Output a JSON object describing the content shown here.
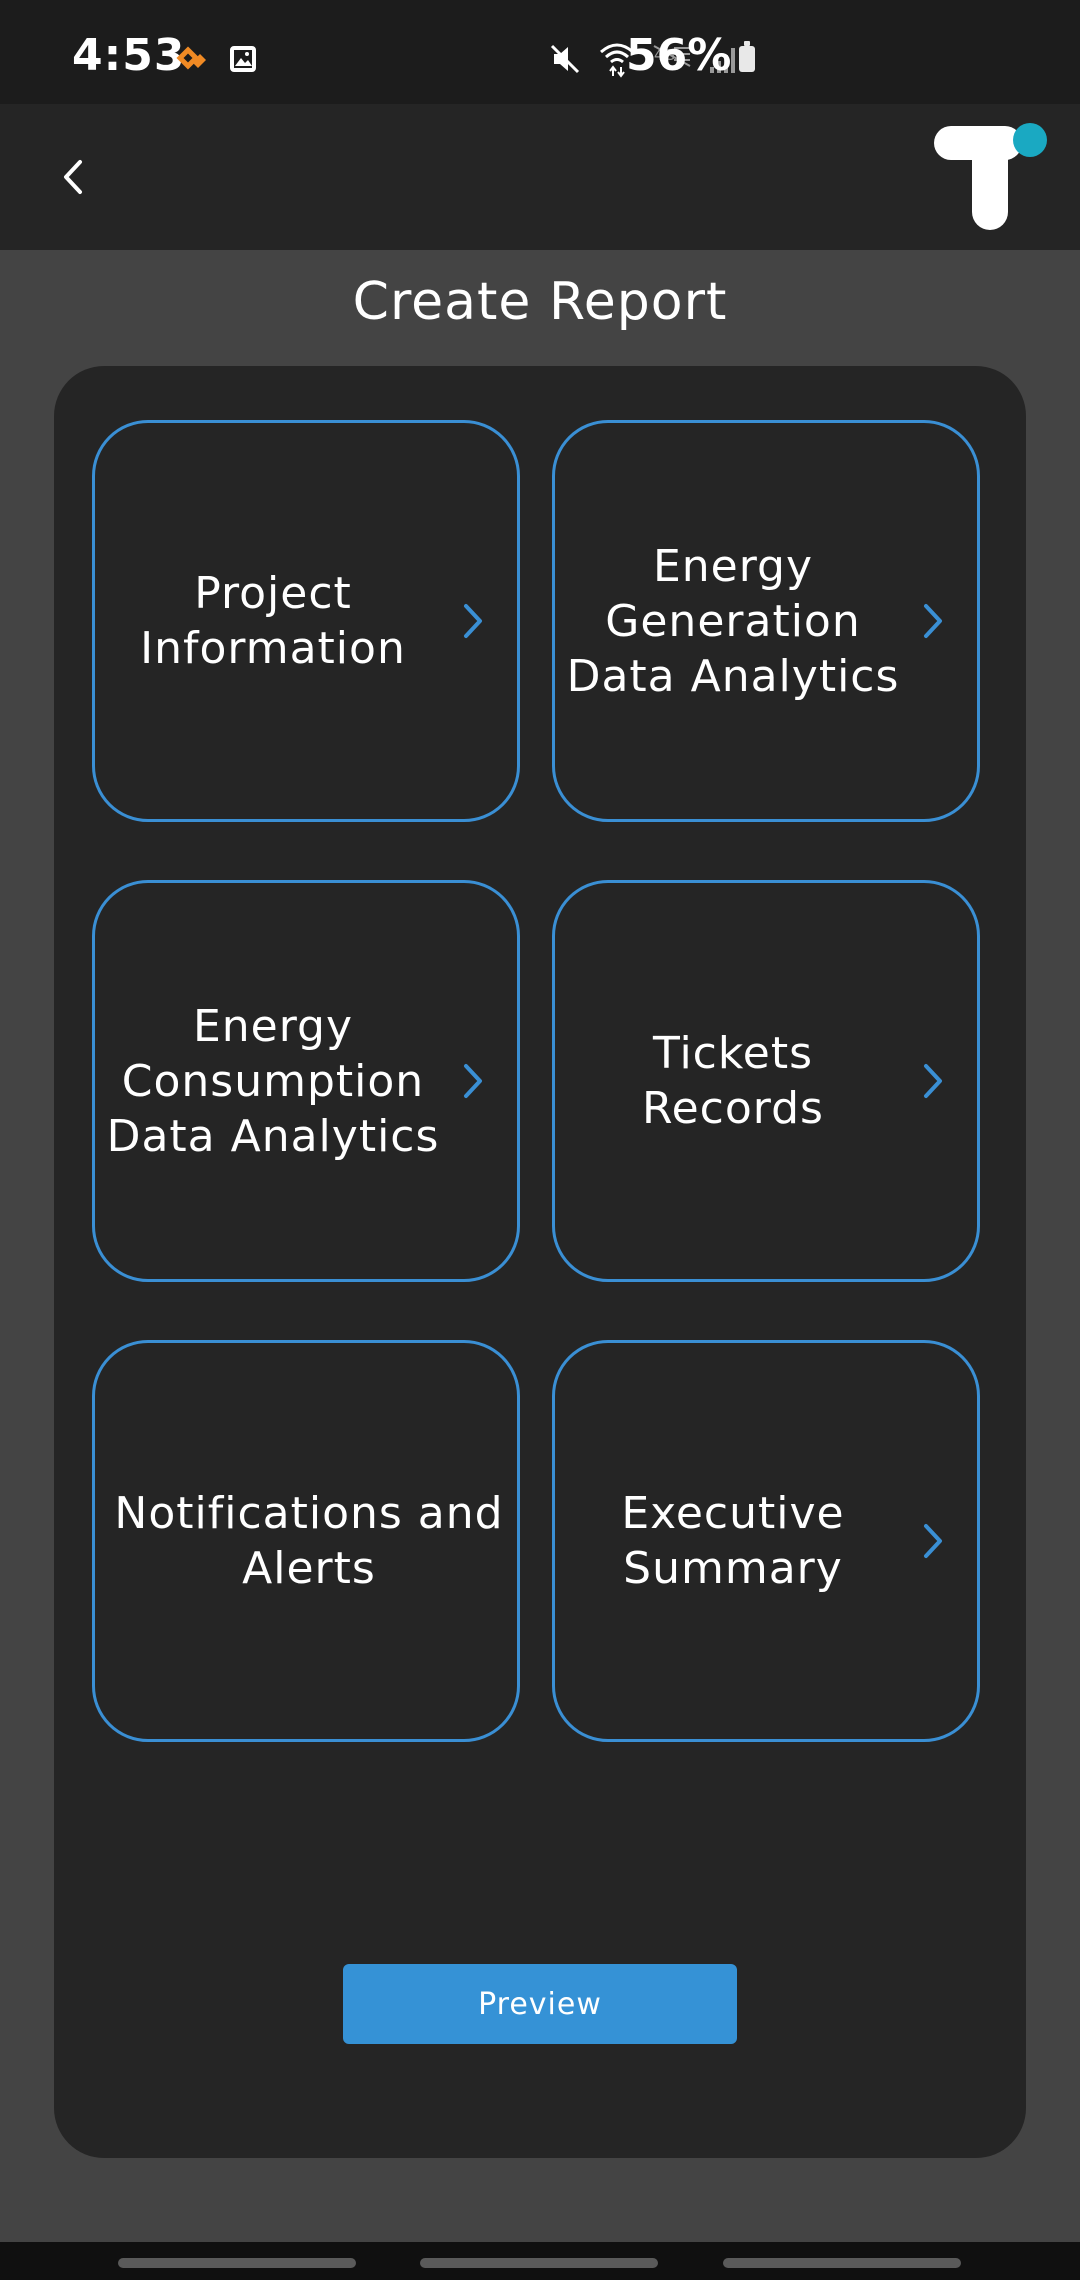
{
  "status_bar": {
    "time": "4:53",
    "battery": "56%",
    "left_icons": [
      "app-notification-icon",
      "gallery-icon"
    ],
    "right_icons": [
      "mute-icon",
      "wifi-icon",
      "no-data-icon",
      "signal-icon",
      "battery-icon"
    ]
  },
  "header": {
    "back_icon": "chevron-left-icon",
    "logo": "t-logo",
    "accent_color": "#1aa9c2"
  },
  "page": {
    "title": "Create Report"
  },
  "cards": [
    {
      "label": "Project Information",
      "has_chevron": true
    },
    {
      "label": "Energy Generation Data Analytics",
      "has_chevron": true
    },
    {
      "label": "Energy Consumption Data Analytics",
      "has_chevron": true
    },
    {
      "label": "Tickets Records",
      "has_chevron": true
    },
    {
      "label": "Notifications and Alerts",
      "has_chevron": false
    },
    {
      "label": "Executive Summary",
      "has_chevron": true
    }
  ],
  "actions": {
    "preview_label": "Preview"
  },
  "colors": {
    "card_border": "#3a8fd4",
    "button": "#3592d6",
    "background": "#444444",
    "panel": "#252525"
  }
}
